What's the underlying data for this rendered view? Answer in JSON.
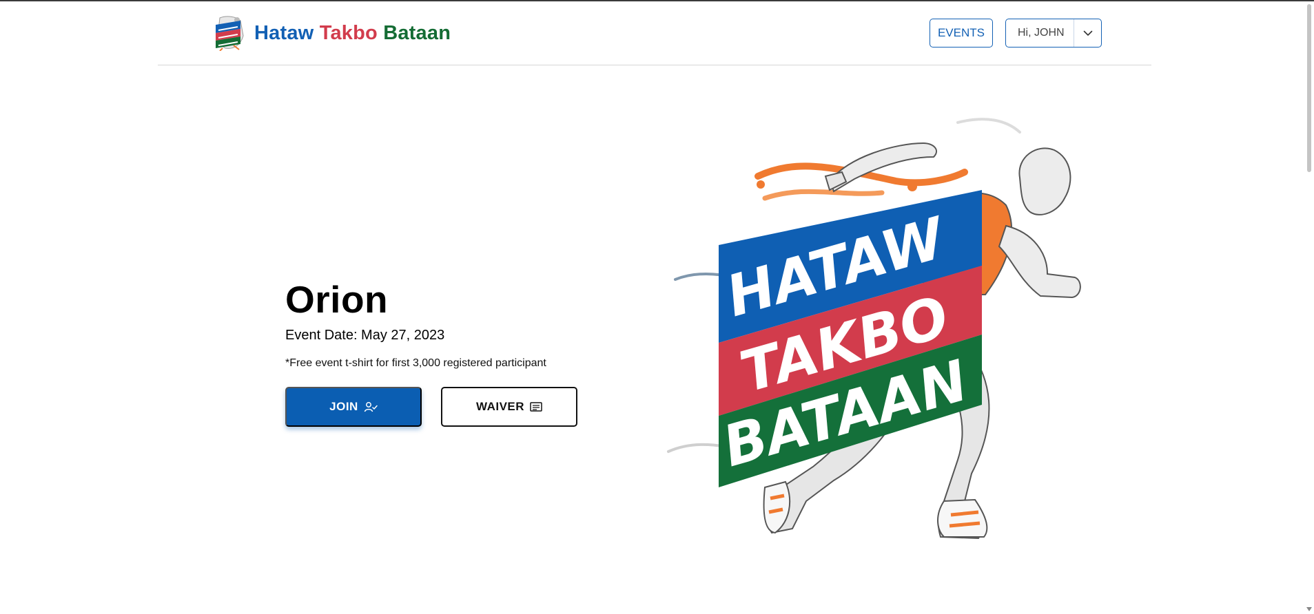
{
  "header": {
    "brand": {
      "logo_icon": "hataw-takbo-bataan-logo",
      "words": [
        "Hataw",
        "Takbo",
        "Bataan"
      ],
      "colors": [
        "#1260b4",
        "#d23c4c",
        "#146c34"
      ]
    },
    "nav": {
      "events_label": "EVENTS",
      "user_greeting": "Hi, JOHN",
      "user_menu_icon": "chevron-down-icon"
    }
  },
  "hero": {
    "event_name": "Orion",
    "event_date": "Event Date: May 27, 2023",
    "note": "*Free event t-shirt for first 3,000 registered participant",
    "join_label": "JOIN",
    "join_icon": "user-check-icon",
    "waiver_label": "WAIVER",
    "waiver_icon": "document-icon",
    "art": {
      "lines": [
        "HATAW",
        "TAKBO",
        "BATAAN"
      ],
      "band_colors": [
        "#0f5fb3",
        "#d23c4c",
        "#14703a"
      ],
      "accent_color": "#f07a30"
    }
  },
  "colors": {
    "primary": "#0b5eb2",
    "text": "#000000"
  }
}
